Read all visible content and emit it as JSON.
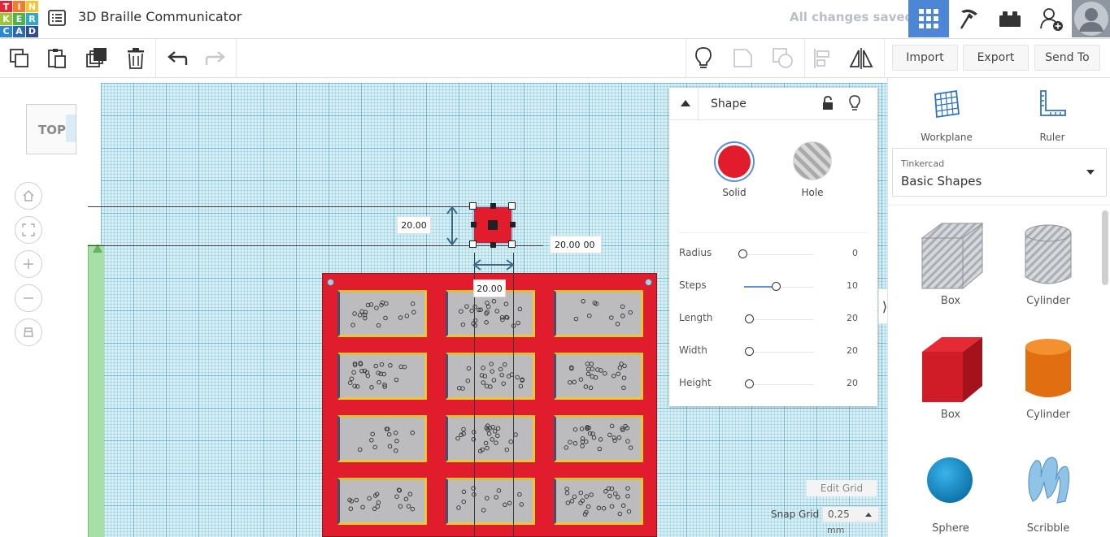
{
  "app": {
    "logo_letters": [
      "T",
      "I",
      "N",
      "K",
      "E",
      "R",
      "C",
      "A",
      "D"
    ],
    "logo_colors": [
      "#e32636",
      "#f47d2a",
      "#f9c52f",
      "#9bc63a",
      "#4fb24c",
      "#33a7c6",
      "#2e87d1",
      "#2b68b3",
      "#2e4b9a"
    ],
    "project_title": "3D Braille Communicator",
    "saved_status": "All changes saved",
    "accent_color": "#4d86d6"
  },
  "toolbar": {
    "import_label": "Import",
    "export_label": "Export",
    "send_to_label": "Send To"
  },
  "viewcube": {
    "face_label": "TOP"
  },
  "dimensions": {
    "depth_label": "20.00",
    "width_label": "20.00",
    "height_label": "20.00",
    "elevation_label": "0.00"
  },
  "shape_panel": {
    "title": "Shape",
    "solid_label": "Solid",
    "hole_label": "Hole",
    "solid_color": "#e11d2d",
    "properties": [
      {
        "label": "Radius",
        "value": "0"
      },
      {
        "label": "Steps",
        "value": "10"
      },
      {
        "label": "Length",
        "value": "20"
      },
      {
        "label": "Width",
        "value": "20"
      },
      {
        "label": "Height",
        "value": "20"
      }
    ]
  },
  "grid_controls": {
    "edit_grid_label": "Edit Grid",
    "snap_grid_label": "Snap Grid",
    "snap_value": "0.25",
    "snap_unit": "mm"
  },
  "right_panel": {
    "workplane_label": "Workplane",
    "ruler_label": "Ruler",
    "library_source": "Tinkercad",
    "library_name": "Basic Shapes",
    "shapes": [
      {
        "label": "Box"
      },
      {
        "label": "Cylinder"
      },
      {
        "label": "Box"
      },
      {
        "label": "Cylinder"
      },
      {
        "label": "Sphere"
      },
      {
        "label": "Scribble"
      }
    ]
  }
}
